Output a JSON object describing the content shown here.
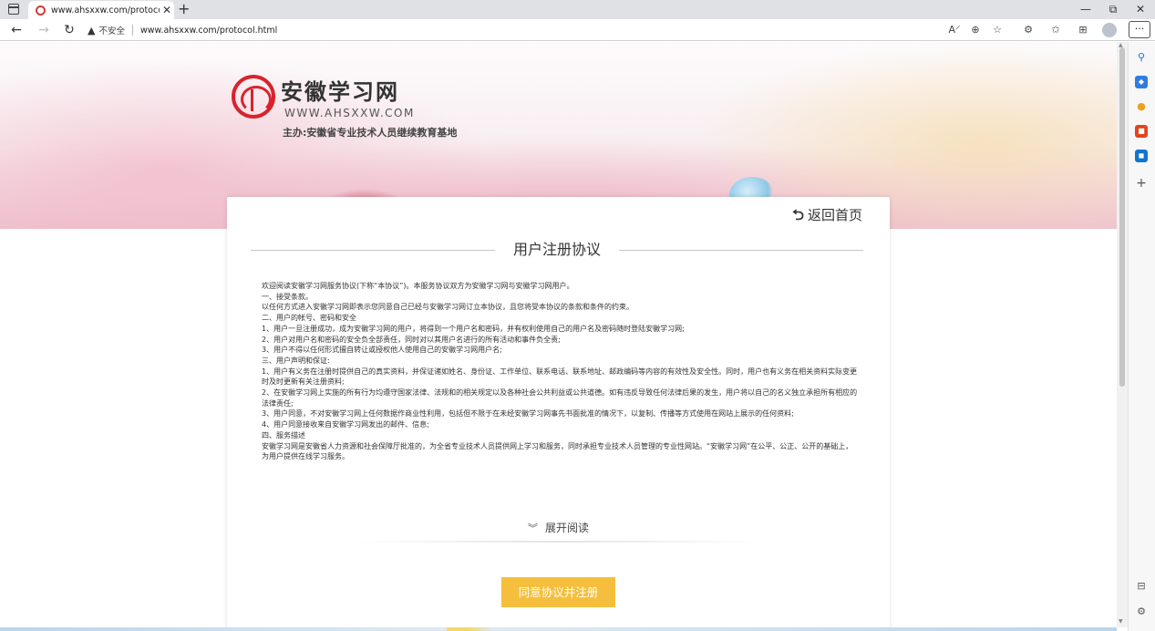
{
  "browser": {
    "tab": {
      "title": "www.ahsxxw.com/protocol.html",
      "close": "✕"
    },
    "new_tab": "+",
    "window_controls": {
      "minimize": "—",
      "restore": "⧉",
      "close": "✕"
    },
    "address": {
      "security_label": "不安全",
      "url": "www.ahsxxw.com/protocol.html"
    },
    "toolbar_icons": [
      "read-aloud-icon",
      "zoom-icon",
      "favorite-icon",
      "extensions-icon",
      "favorites-icon",
      "collections-icon",
      "profile-icon",
      "more-icon"
    ],
    "more_label": "···"
  },
  "sidebar": {
    "icons": [
      "search-icon",
      "shopping-icon",
      "people-icon",
      "office-icon",
      "outlook-icon",
      "add-icon",
      "hide-sidebar-icon",
      "settings-icon"
    ]
  },
  "header": {
    "site_name": "安徽学习网",
    "site_domain": "WWW.AHSXXW.COM",
    "host": "主办:安徽省专业技术人员继续教育基地"
  },
  "card": {
    "back_home": "返回首页",
    "title": "用户注册协议",
    "protocol_lines": [
      "欢迎阅读安徽学习网服务协议(下称“本协议”)。本服务协议双方为安徽学习网与安徽学习网用户。",
      "一、接受条款。",
      "以任何方式进入安徽学习网即表示您同意自己已经与安徽学习网订立本协议，且您将受本协议的条款和条件的约束。",
      "二、用户的帐号、密码和安全",
      "1、用户一旦注册成功，成为安徽学习网的用户，将得到一个用户名和密码，并有权利使用自己的用户名及密码随时登陆安徽学习网;",
      "2、用户对用户名和密码的安全负全部责任，同时对以其用户名进行的所有活动和事件负全责;",
      "3、用户不得以任何形式擅自转让或授权他人使用自己的安徽学习网用户名;",
      "三、用户声明和保证:",
      "1、用户有义务在注册时提供自己的真实资料，并保证诸如姓名、身份证、工作单位、联系电话、联系地址、邮政编码等内容的有效性及安全性。同时，用户也有义务在相关资料实际变更时及时更新有关注册资料;",
      "2、在安徽学习网上实施的所有行为均遵守国家法律、法规和的相关规定以及各种社会公共利益或公共道德。如有违反导致任何法律后果的发生，用户将以自己的名义独立承担所有相应的法律责任;",
      "3、用户同意，不对安徽学习网上任何数据作商业性利用，包括但不限于在未经安徽学习网事先书面批准的情况下，以复制、传播等方式使用在网站上展示的任何资料;",
      "4、用户同意接收来自安徽学习网发出的邮件、信息;",
      "四、服务描述",
      "安徽学习网是安徽省人力资源和社会保障厅批准的，为全省专业技术人员提供网上学习和服务，同时承担专业技术人员管理的专业性网站。“安徽学习网”在公平、公正、公开的基础上，为用户提供在线学习服务。"
    ],
    "expand_label": "展开阅读",
    "agree_button": "同意协议并注册"
  },
  "colors": {
    "brand_red": "#d9232a",
    "button_yellow": "#f5bf3d"
  }
}
